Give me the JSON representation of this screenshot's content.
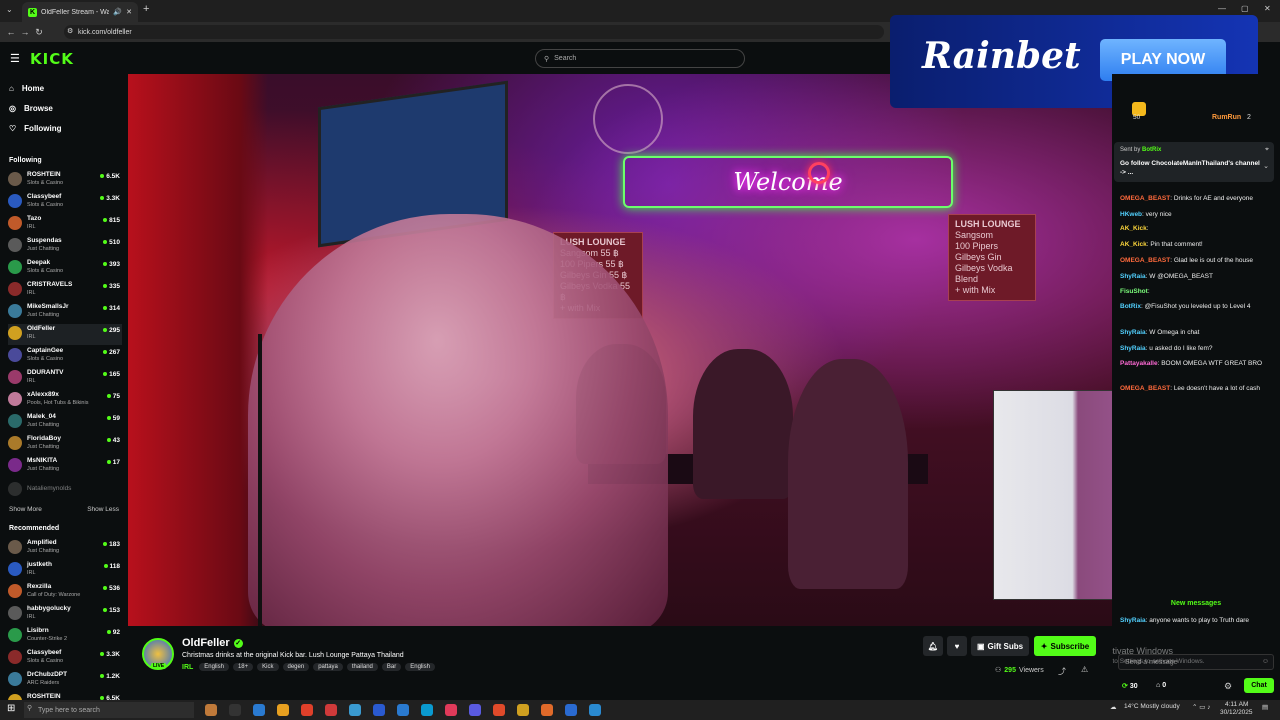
{
  "browser": {
    "tab_title": "OldFeller Stream - Watch L",
    "url": "kick.com/oldfeller"
  },
  "header": {
    "logo": "KICK",
    "search_placeholder": "Search"
  },
  "nav": [
    {
      "label": "Home",
      "icon": "home-icon"
    },
    {
      "label": "Browse",
      "icon": "compass-icon"
    },
    {
      "label": "Following",
      "icon": "heart-icon"
    }
  ],
  "following": {
    "heading": "Following",
    "channels": [
      {
        "name": "ROSHTEIN",
        "category": "Slots & Casino",
        "viewers": "6.5K"
      },
      {
        "name": "Classybeef",
        "category": "Slots & Casino",
        "viewers": "3.3K"
      },
      {
        "name": "Tazo",
        "category": "IRL",
        "viewers": "815"
      },
      {
        "name": "Suspendas",
        "category": "Just Chatting",
        "viewers": "510"
      },
      {
        "name": "Deepak",
        "category": "Slots & Casino",
        "viewers": "393"
      },
      {
        "name": "CRISTRAVELS",
        "category": "IRL",
        "viewers": "335"
      },
      {
        "name": "MikeSmallsJr",
        "category": "Just Chatting",
        "viewers": "314"
      },
      {
        "name": "OldFeller",
        "category": "IRL",
        "viewers": "295"
      },
      {
        "name": "CaptainGee",
        "category": "Slots & Casino",
        "viewers": "267"
      },
      {
        "name": "DDURANTV",
        "category": "IRL",
        "viewers": "165"
      },
      {
        "name": "xAlexx89x",
        "category": "Pools, Hot Tubs & Bikinis",
        "viewers": "75"
      },
      {
        "name": "Malek_04",
        "category": "Just Chatting",
        "viewers": "59"
      },
      {
        "name": "FloridaBoy",
        "category": "Just Chatting",
        "viewers": "43"
      },
      {
        "name": "MsNIKITA",
        "category": "Just Chatting",
        "viewers": "17"
      }
    ],
    "offline": "Nataliemynolds",
    "show_more": "Show More",
    "show_less": "Show Less"
  },
  "recommended": {
    "heading": "Recommended",
    "channels": [
      {
        "name": "Amplified",
        "category": "Just Chatting",
        "viewers": "183"
      },
      {
        "name": "justketh",
        "category": "IRL",
        "viewers": "118"
      },
      {
        "name": "Rexzilla",
        "category": "Call of Duty: Warzone",
        "viewers": "536"
      },
      {
        "name": "habbygolucky",
        "category": "IRL",
        "viewers": "153"
      },
      {
        "name": "Lisibrn",
        "category": "Counter-Strike 2",
        "viewers": "92"
      },
      {
        "name": "Classybeef",
        "category": "Slots & Casino",
        "viewers": "3.3K"
      },
      {
        "name": "DrChubzDPT",
        "category": "ARC Raiders",
        "viewers": "1.2K"
      },
      {
        "name": "ROSHTEIN",
        "category": "",
        "viewers": "6.5K"
      }
    ]
  },
  "ad": {
    "brand": "Rainbet",
    "cta": "PLAY NOW"
  },
  "scene": {
    "neon_sign": "Welcome",
    "menu_left": [
      "LUSH LOUNGE",
      "Sangsom  55 ฿",
      "100 Pipers  55 ฿",
      "Gilbeys Gin  55 ฿",
      "Gilbeys Vodka  55 ฿",
      "+ with Mix"
    ],
    "menu_right": [
      "LUSH LOUNGE",
      "Sangsom",
      "100 Pipers",
      "Gilbeys Gin",
      "Gilbeys Vodka",
      "Blend",
      "+ with Mix"
    ]
  },
  "chat": {
    "top_user": "RumRun",
    "top_user_count": "2",
    "top_badge_count": "50",
    "pinned": {
      "sender": "Sent by",
      "bot": "BotRix",
      "text": "Go follow ChocolateManInThailand's channel -> ..."
    },
    "messages": [
      {
        "user": "OMEGA_BEAST",
        "text": ": Drinks for AE and everyone",
        "color": "#ff6a3c"
      },
      {
        "user": "HKweb",
        "text": ": very nice",
        "color": "#52d1ff"
      },
      {
        "user": "AK_Kick",
        "text": ":",
        "color": "#ffd83c"
      },
      {
        "user": "AK_Kick",
        "text": ": Pin that comment!",
        "color": "#ffd83c"
      },
      {
        "user": "OMEGA_BEAST",
        "text": ": Glad lee is out of the house",
        "color": "#ff6a3c"
      },
      {
        "user": "ShyRaia",
        "text": ": W @OMEGA_BEAST",
        "color": "#52d1ff"
      },
      {
        "user": "FisuShot",
        "text": ":",
        "color": "#7cff7c"
      },
      {
        "user": "BotRix",
        "text": ": @FisuShot you leveled up to Level 4",
        "color": "#52d1ff"
      },
      {
        "user": "ShyRaia",
        "text": ": W Omega in chat",
        "color": "#52d1ff"
      },
      {
        "user": "ShyRaia",
        "text": ": u asked do I like fem?",
        "color": "#52d1ff"
      },
      {
        "user": "Pattayakalle",
        "text": ": BOOM OMEGA WTF GREAT BRO",
        "color": "#ff6ad5"
      },
      {
        "user": "OMEGA_BEAST",
        "text": ": Lee doesn't have a lot of cash",
        "color": "#ff6a3c"
      }
    ],
    "new_messages": "New messages",
    "last_message": {
      "user": "ShyRaia",
      "text": ": anyone wants to play to Truth dare"
    },
    "input_placeholder": "Send a message",
    "activate_title": "Activate Windows",
    "activate_sub": "Go to Settings to activate Windows.",
    "points": "30",
    "gifts": "0",
    "chat_button": "Chat"
  },
  "stream": {
    "channel": "OldFeller",
    "title": "Christmas drinks at the original Kick bar. Lush Lounge Pattaya Thailand",
    "live_badge": "LIVE",
    "category": "IRL",
    "tags": [
      "English",
      "18+",
      "Kick",
      "degen",
      "pattaya",
      "thailand",
      "Bar",
      "English"
    ],
    "viewers": "295",
    "viewers_label": "Viewers",
    "gift_subs": "Gift Subs",
    "subscribe": "Subscribe"
  },
  "taskbar": {
    "search_placeholder": "Type here to search",
    "weather": "14°C  Mostly cloudy",
    "time": "4:11 AM",
    "date": "30/12/2025"
  },
  "colors": {
    "kick_green": "#53fc18",
    "background": "#0b0e0f"
  }
}
